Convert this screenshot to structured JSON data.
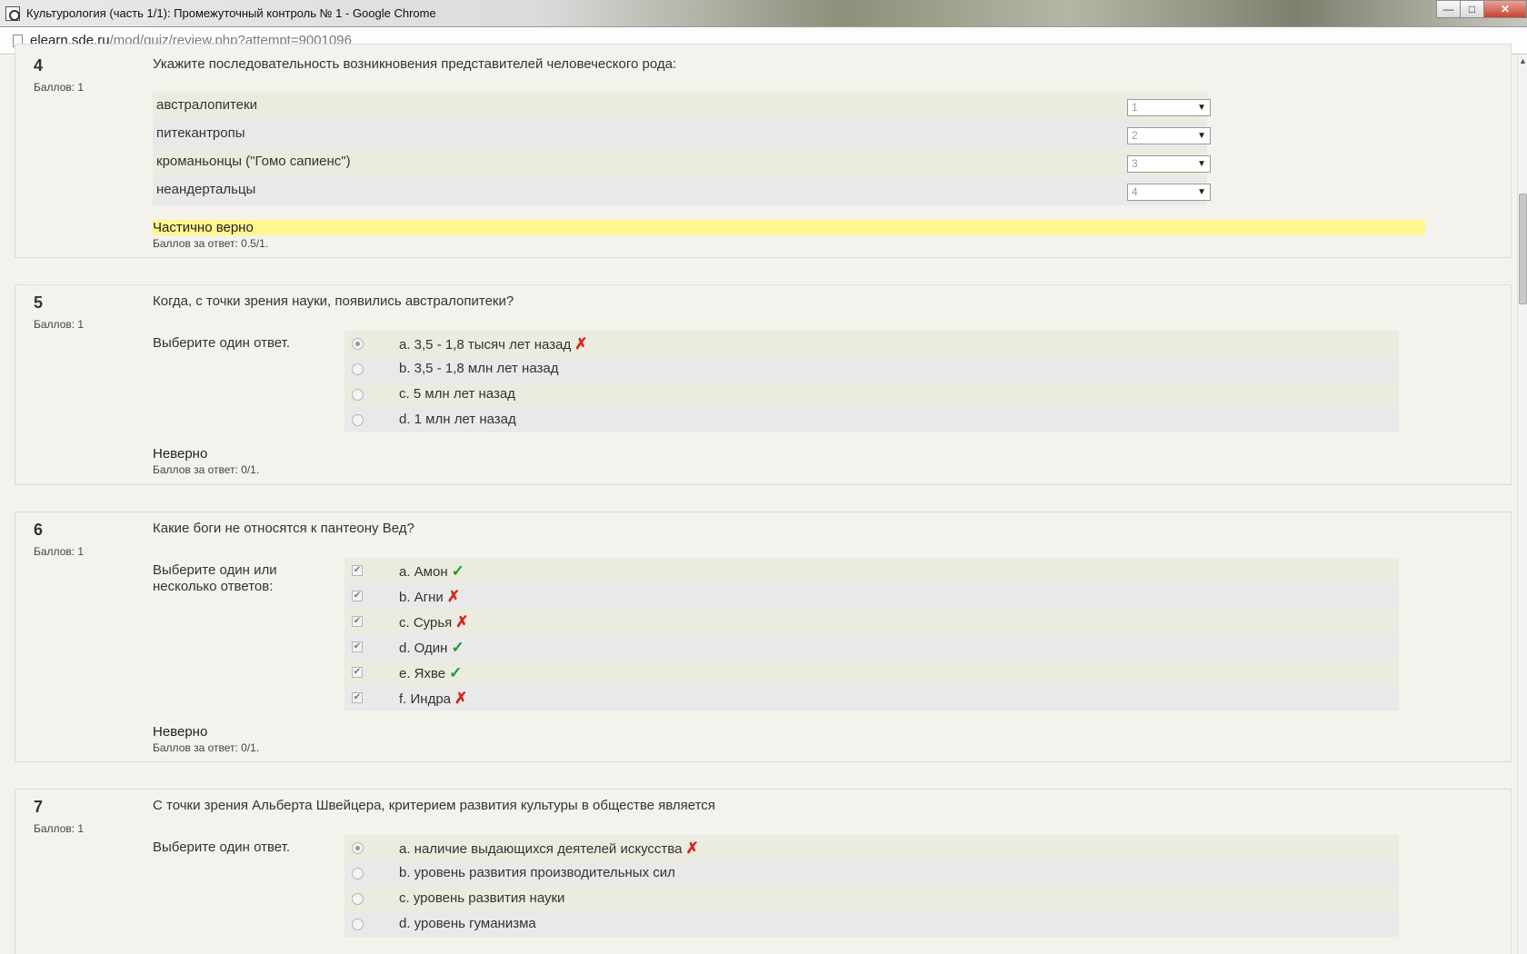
{
  "window": {
    "title": "Культурология (часть 1/1): Промежуточный контроль № 1 - Google Chrome",
    "minimize": "—",
    "maximize": "□",
    "close": "✕"
  },
  "address": {
    "host": "elearn.sde.ru",
    "path": "/mod/quiz/review.php?attempt=9001096"
  },
  "questions": {
    "q4": {
      "number": "4",
      "grade": "Баллов: 1",
      "text": "Укажите последовательность возникновения представителей человеческого рода:",
      "rows": [
        {
          "label": "австралопитеки",
          "value": "1"
        },
        {
          "label": "питекантропы",
          "value": "2"
        },
        {
          "label": "кроманьонцы (\"Гомо сапиенс\")",
          "value": "3"
        },
        {
          "label": "неандертальцы",
          "value": "4"
        }
      ],
      "outcome": "Частично верно",
      "score": "Баллов за ответ: 0.5/1."
    },
    "q5": {
      "number": "5",
      "grade": "Баллов: 1",
      "text": "Когда, с точки зрения науки, появились австралопитеки?",
      "prompt": "Выберите один ответ.",
      "answers": [
        {
          "text": "a. 3,5 - 1,8 тысяч лет назад",
          "mark": "✗",
          "checked": true
        },
        {
          "text": "b. 3,5 - 1,8 млн лет назад",
          "mark": "",
          "checked": false
        },
        {
          "text": "c. 5 млн лет назад",
          "mark": "",
          "checked": false
        },
        {
          "text": "d. 1 млн лет назад",
          "mark": "",
          "checked": false
        }
      ],
      "outcome": "Неверно",
      "score": "Баллов за ответ: 0/1."
    },
    "q6": {
      "number": "6",
      "grade": "Баллов: 1",
      "text": "Какие боги не относятся к пантеону Вед?",
      "prompt": "Выберите один или несколько ответов:",
      "answers": [
        {
          "text": "a. Амон",
          "mark": "✓",
          "checked": true
        },
        {
          "text": "b. Агни",
          "mark": "✗",
          "checked": true
        },
        {
          "text": "c. Сурья",
          "mark": "✗",
          "checked": true
        },
        {
          "text": "d. Один",
          "mark": "✓",
          "checked": true
        },
        {
          "text": "e. Яхве",
          "mark": "✓",
          "checked": true
        },
        {
          "text": "f. Индра",
          "mark": "✗",
          "checked": true
        }
      ],
      "outcome": "Неверно",
      "score": "Баллов за ответ: 0/1."
    },
    "q7": {
      "number": "7",
      "grade": "Баллов: 1",
      "text": "С точки зрения Альберта Швейцера, критерием развития культуры в обществе является",
      "prompt": "Выберите один ответ.",
      "answers": [
        {
          "text": "a. наличие выдающихся деятелей искусства",
          "mark": "✗",
          "checked": true
        },
        {
          "text": "b. уровень развития производительных сил",
          "mark": "",
          "checked": false
        },
        {
          "text": "c. уровень развития науки",
          "mark": "",
          "checked": false
        },
        {
          "text": "d. уровень гуманизма",
          "mark": "",
          "checked": false
        }
      ]
    }
  },
  "colors": {
    "partial_highlight": "#fff68f",
    "wrong_mark": "#d3251d",
    "right_mark": "#1a9a2a"
  }
}
